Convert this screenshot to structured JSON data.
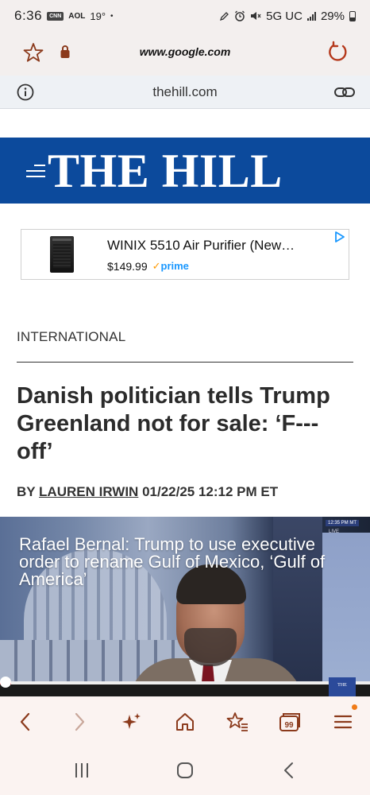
{
  "status_bar": {
    "time": "6:36",
    "badge_cnn": "CNN",
    "badge_aol": "AOL",
    "temperature": "19°",
    "dot": "•",
    "network": "5G UC",
    "battery": "29%"
  },
  "browser": {
    "url": "www.google.com",
    "site_domain": "thehill.com"
  },
  "site": {
    "logo": "THE HILL",
    "brand_color": "#0c4a9c"
  },
  "ad": {
    "title": "WINIX 5510 Air Purifier (New…",
    "price": "$149.99",
    "prime_label": "prime"
  },
  "article": {
    "section": "INTERNATIONAL",
    "headline": "Danish politician tells Trump Greenland not for sale: ‘F--- off’",
    "byline_prefix": "BY",
    "author": "LAUREN IRWIN",
    "date": "01/22/25 12:12 PM ET"
  },
  "video": {
    "caption": "Rafael Bernal: Trump to use executive order to rename Gulf of Mexico, ‘Gulf of America’",
    "chyron_time": "12:35 PM MT",
    "live_label": "LIVE",
    "corner_logo": "THE",
    "progress": 0.03
  },
  "icons": {
    "status": [
      "cnn-icon",
      "aol-icon",
      "pencil-icon",
      "alarm-icon",
      "mute-icon",
      "signal-icon",
      "battery-icon"
    ],
    "url_bar": [
      "star-icon",
      "lock-icon",
      "reload-icon"
    ],
    "site_bar": [
      "info-icon",
      "link-icon"
    ],
    "toolbar": [
      "back-icon",
      "forward-icon",
      "sparkle-icon",
      "home-icon",
      "bookmarks-icon",
      "tabs-icon",
      "menu-icon"
    ],
    "android_nav": [
      "recents-icon",
      "home-nav-icon",
      "back-nav-icon"
    ]
  },
  "toolbar": {
    "tabs_count": "99"
  },
  "colors": {
    "accent": "#8b3a1c",
    "notification_dot": "#f07b18",
    "prime_blue": "#1a98ff"
  }
}
